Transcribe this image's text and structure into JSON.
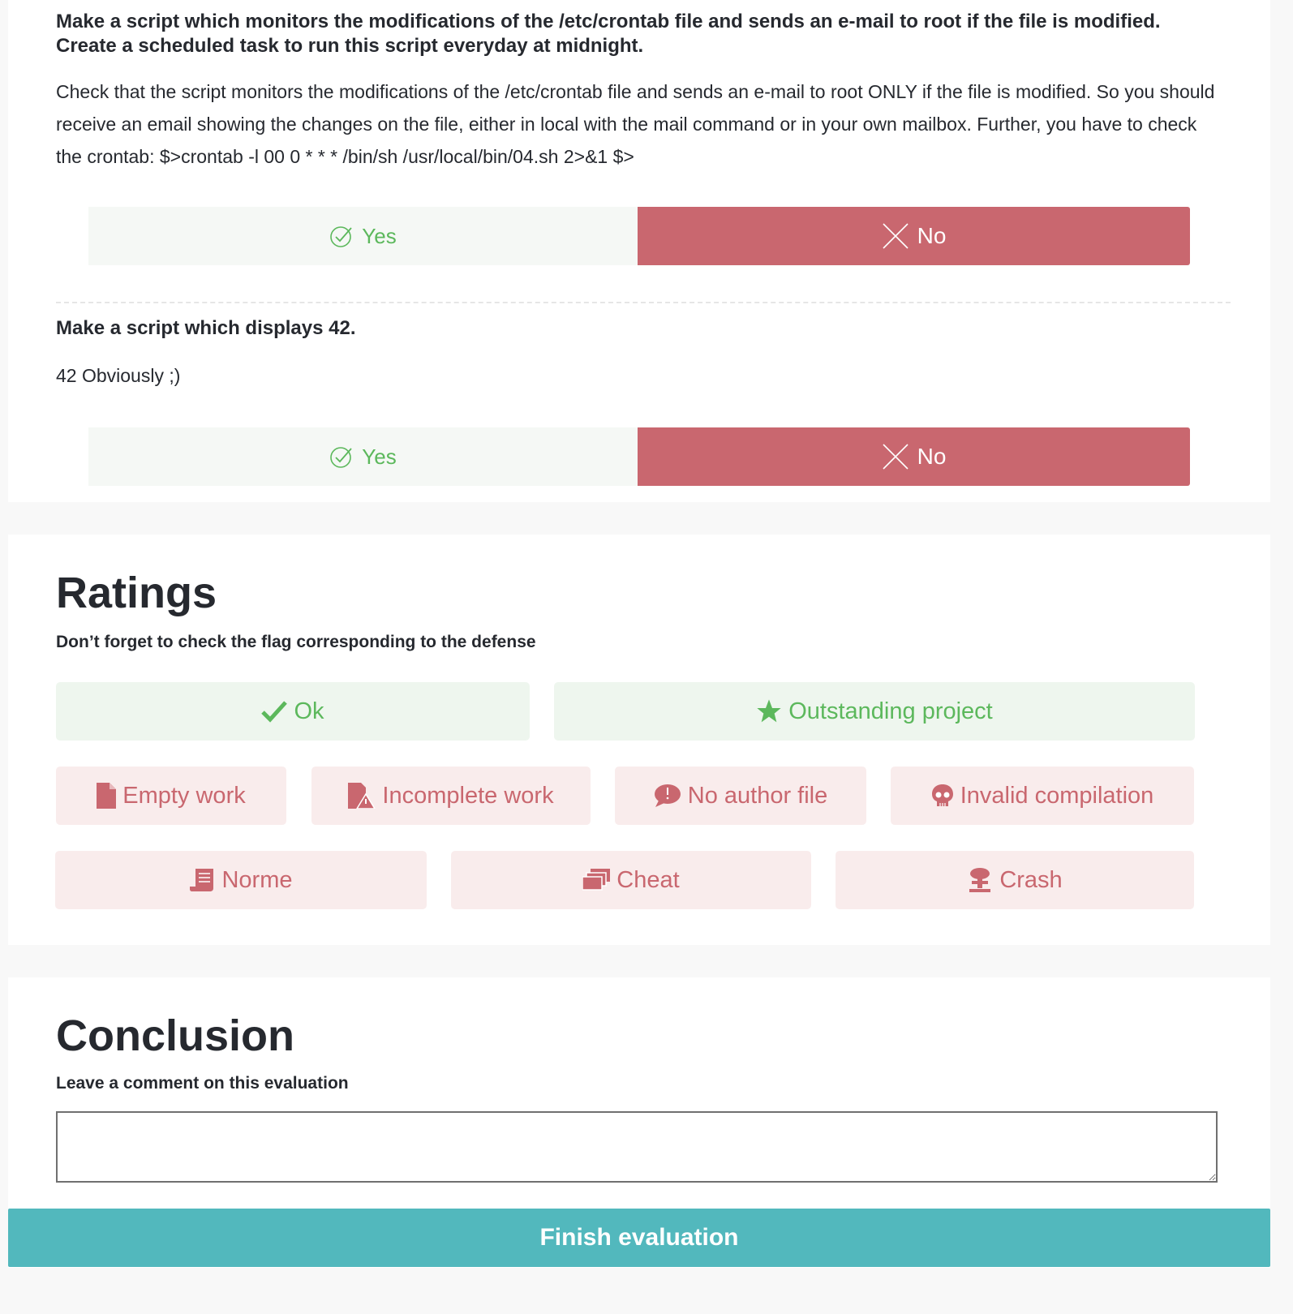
{
  "questions": [
    {
      "title": "Make a script which monitors the modifications of the /etc/crontab file and sends an e-mail to root if the file is modified. Create a scheduled task to run this script everyday at midnight.",
      "description": "Check that the script monitors the modifications of the /etc/crontab file and sends an e-mail to root ONLY if the file is modified. So you should receive an email showing the changes on the file, either in local with the mail command or in your own mailbox. Further, you have to check the crontab: $>crontab -l 00 0 * * * /bin/sh /usr/local/bin/04.sh 2>&1 $>",
      "yes_label": "Yes",
      "no_label": "No",
      "selected": "No"
    },
    {
      "title": "Make a script which displays 42.",
      "description": "42 Obviously ;)",
      "yes_label": "Yes",
      "no_label": "No",
      "selected": "No"
    }
  ],
  "ratings": {
    "title": "Ratings",
    "subtitle": "Don’t forget to check the flag corresponding to the defense",
    "flags": [
      {
        "label": "Ok",
        "icon": "check-icon",
        "kind": "good"
      },
      {
        "label": "Outstanding project",
        "icon": "star-icon",
        "kind": "good"
      },
      {
        "label": "Empty work",
        "icon": "file-icon",
        "kind": "bad"
      },
      {
        "label": "Incomplete work",
        "icon": "file-warning-icon",
        "kind": "bad"
      },
      {
        "label": "No author file",
        "icon": "speech-bubble-alert-icon",
        "kind": "bad"
      },
      {
        "label": "Invalid compilation",
        "icon": "skull-icon",
        "kind": "bad"
      },
      {
        "label": "Norme",
        "icon": "scroll-icon",
        "kind": "bad"
      },
      {
        "label": "Cheat",
        "icon": "cards-icon",
        "kind": "bad"
      },
      {
        "label": "Crash",
        "icon": "mushroom-cloud-icon",
        "kind": "bad"
      }
    ]
  },
  "conclusion": {
    "title": "Conclusion",
    "subtitle": "Leave a comment on this evaluation",
    "comment_value": "",
    "finish_label": "Finish evaluation"
  },
  "colors": {
    "yes_green": "#5cb85c",
    "no_red": "#c9676f",
    "finish_teal": "#52b8bd"
  }
}
